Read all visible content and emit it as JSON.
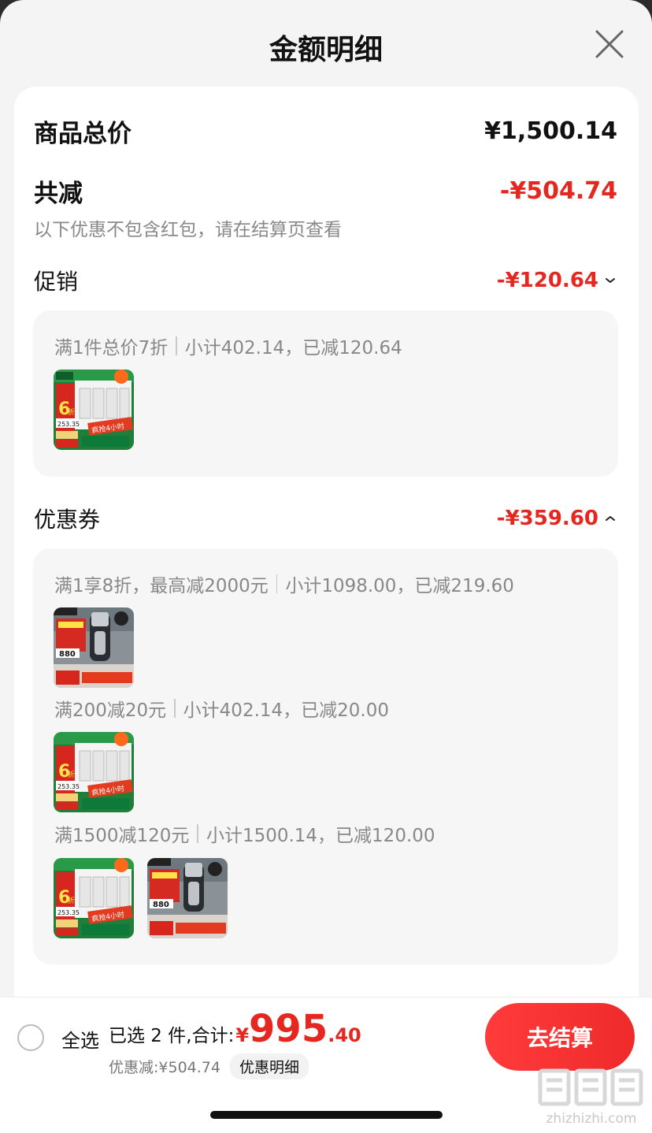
{
  "header": {
    "title": "金额明细"
  },
  "summary": {
    "total_label": "商品总价",
    "total_value": "¥1,500.14",
    "reduce_label": "共减",
    "reduce_value": "-¥504.74",
    "note": "以下优惠不包含红包，请在结算页查看"
  },
  "promotion": {
    "label": "促销",
    "value": "-¥120.64",
    "expanded": false,
    "rules": [
      {
        "condition": "满1件总价7折",
        "detail": "小计402.14，已减120.64",
        "products": [
          "breaker-product-image"
        ]
      }
    ]
  },
  "coupon": {
    "label": "优惠券",
    "value": "-¥359.60",
    "expanded": true,
    "rules": [
      {
        "condition": "满1享8折，最高减2000元",
        "detail": "小计1098.00，已减219.60",
        "products": [
          "shaver-product-image"
        ]
      },
      {
        "condition": "满200减20元",
        "detail": "小计402.14，已减20.00",
        "products": [
          "breaker-product-image"
        ]
      },
      {
        "condition": "满1500减120元",
        "detail": "小计1500.14，已减120.00",
        "products": [
          "breaker-product-image",
          "shaver-product-image"
        ]
      }
    ]
  },
  "product_badges": {
    "breaker": {
      "discount": "6",
      "discount_unit": "折",
      "price": "253.35",
      "promo": "疯抢4小时"
    },
    "shaver": {
      "price": "880"
    }
  },
  "bottom_bar": {
    "select_all": "全选",
    "selected_summary": "已选 2 件,合计:",
    "currency": "¥",
    "price_int": "995",
    "price_dec": ".40",
    "discount_text": "优惠减:¥504.74",
    "detail_chip": "优惠明细",
    "checkout": "去结算"
  },
  "watermark": {
    "text": "zhizhizhi.com"
  },
  "colors": {
    "accent_red": "#e5271f",
    "checkout_red": "#ff3b3b",
    "bg": "#f4f4f4",
    "panel": "#f6f6f6"
  },
  "icons": [
    "close-icon",
    "chevron-down-icon",
    "chevron-up-icon",
    "radio-unchecked-icon"
  ]
}
